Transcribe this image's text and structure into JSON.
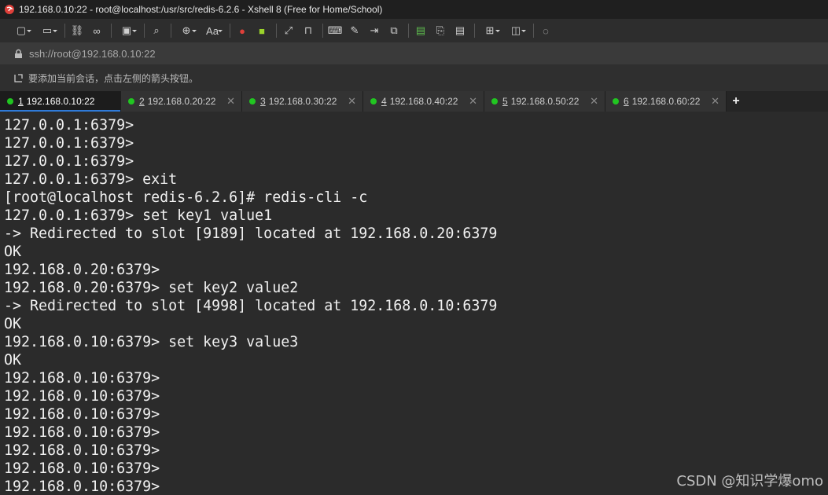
{
  "window": {
    "title": "192.168.0.10:22 - root@localhost:/usr/src/redis-6.2.6 - Xshell 8 (Free for Home/School)"
  },
  "toolbar": {
    "icons": [
      "new-session-icon",
      "open-folder-icon",
      "reconnect-icon",
      "disconnect-icon",
      "transfer-icon",
      "find-icon",
      "globe-icon",
      "font-icon",
      "xshell-icon",
      "xftp-icon",
      "fullscreen-icon",
      "lock-icon",
      "keyboard-icon",
      "script-icon",
      "log-icon",
      "compose-icon",
      "tunnel-icon",
      "copy-icon",
      "paste-icon",
      "new-tab-icon",
      "layout-icon",
      "help-icon"
    ],
    "font_label": "Aa"
  },
  "address": {
    "value": "ssh://root@192.168.0.10:22"
  },
  "hint": {
    "text": "要添加当前会话，点击左侧的箭头按钮。"
  },
  "tabs": [
    {
      "num": "1",
      "label": "192.168.0.10:22",
      "active": true
    },
    {
      "num": "2",
      "label": "192.168.0.20:22",
      "active": false
    },
    {
      "num": "3",
      "label": "192.168.0.30:22",
      "active": false
    },
    {
      "num": "4",
      "label": "192.168.0.40:22",
      "active": false
    },
    {
      "num": "5",
      "label": "192.168.0.50:22",
      "active": false
    },
    {
      "num": "6",
      "label": "192.168.0.60:22",
      "active": false
    }
  ],
  "tab_add_label": "+",
  "terminal": {
    "lines": [
      "127.0.0.1:6379>",
      "127.0.0.1:6379>",
      "127.0.0.1:6379>",
      "127.0.0.1:6379> exit",
      "[root@localhost redis-6.2.6]# redis-cli -c",
      "127.0.0.1:6379> set key1 value1",
      "-> Redirected to slot [9189] located at 192.168.0.20:6379",
      "OK",
      "192.168.0.20:6379>",
      "192.168.0.20:6379> set key2 value2",
      "-> Redirected to slot [4998] located at 192.168.0.10:6379",
      "OK",
      "192.168.0.10:6379> set key3 value3",
      "OK",
      "192.168.0.10:6379>",
      "192.168.0.10:6379>",
      "192.168.0.10:6379>",
      "192.168.0.10:6379>",
      "192.168.0.10:6379>",
      "192.168.0.10:6379>",
      "192.168.0.10:6379>"
    ]
  },
  "watermark": "CSDN @知识学爆omo"
}
